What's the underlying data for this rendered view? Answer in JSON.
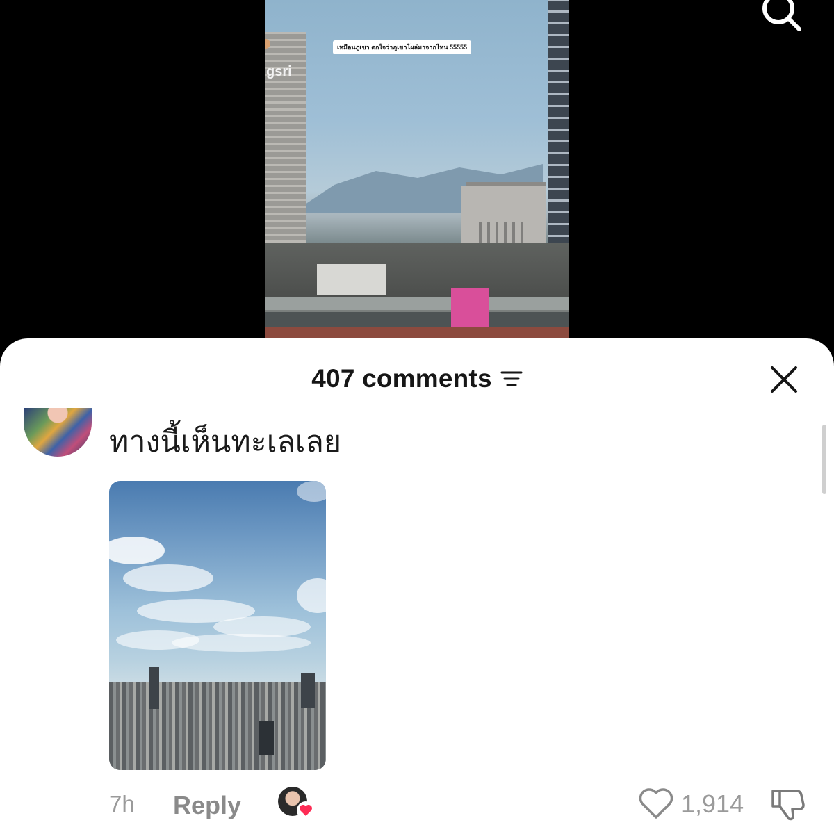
{
  "video": {
    "caption": "เหมือนภูเขา ตกใจว่าภูเขาโผล่มาจากไหน 55555",
    "building_sign": "gsri"
  },
  "comments_sheet": {
    "count_label": "407 comments",
    "comment": {
      "text": "ทางนี้เห็นทะเลเลย",
      "time": "7h",
      "reply_label": "Reply",
      "like_count": "1,914"
    }
  },
  "colors": {
    "sheet_bg": "#ffffff",
    "creator_heart": "#fe2c55",
    "meta_text": "#9a9a9a"
  },
  "icons": [
    "search-icon",
    "sort-icon",
    "close-icon",
    "heart-icon",
    "dislike-icon"
  ]
}
